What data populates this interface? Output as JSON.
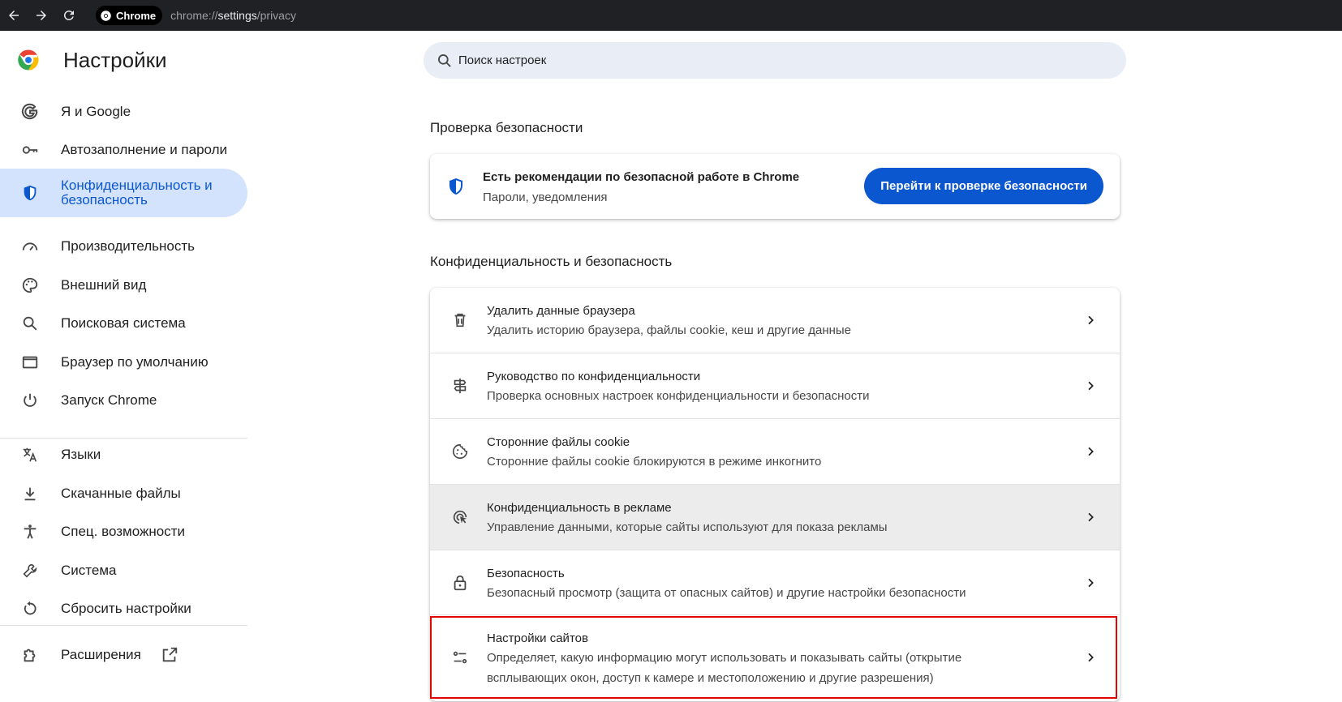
{
  "browser": {
    "chip_label": "Chrome",
    "url_prefix": "chrome://",
    "url_main": "settings",
    "url_suffix": "/privacy"
  },
  "sidebar": {
    "title": "Настройки",
    "items": [
      {
        "label": "Я и Google",
        "icon": "google-g-icon"
      },
      {
        "label": "Автозаполнение и пароли",
        "icon": "key-icon"
      },
      {
        "label": "Конфиденциальность и безопасность",
        "icon": "shield-icon",
        "active": true
      },
      {
        "label": "Производительность",
        "icon": "speedometer-icon"
      },
      {
        "label": "Внешний вид",
        "icon": "palette-icon"
      },
      {
        "label": "Поисковая система",
        "icon": "search-icon"
      },
      {
        "label": "Браузер по умолчанию",
        "icon": "browser-window-icon"
      },
      {
        "label": "Запуск Chrome",
        "icon": "power-icon"
      },
      {
        "label": "Языки",
        "icon": "translate-icon"
      },
      {
        "label": "Скачанные файлы",
        "icon": "download-icon"
      },
      {
        "label": "Спец. возможности",
        "icon": "accessibility-icon"
      },
      {
        "label": "Система",
        "icon": "wrench-icon"
      },
      {
        "label": "Сбросить настройки",
        "icon": "reset-icon"
      },
      {
        "label": "Расширения",
        "icon": "puzzle-icon"
      }
    ]
  },
  "search": {
    "placeholder": "Поиск настроек"
  },
  "safety": {
    "section_title": "Проверка безопасности",
    "title": "Есть рекомендации по безопасной работе в Chrome",
    "subtitle": "Пароли, уведомления",
    "button": "Перейти к проверке безопасности"
  },
  "privacy": {
    "section_title": "Конфиденциальность и безопасность",
    "rows": [
      {
        "title": "Удалить данные браузера",
        "subtitle": "Удалить историю браузера, файлы cookie, кеш и другие данные",
        "icon": "trash-icon"
      },
      {
        "title": "Руководство по конфиденциальности",
        "subtitle": "Проверка основных настроек конфиденциальности и безопасности",
        "icon": "signpost-icon"
      },
      {
        "title": "Сторонние файлы cookie",
        "subtitle": "Сторонние файлы cookie блокируются в режиме инкогнито",
        "icon": "cookie-icon"
      },
      {
        "title": "Конфиденциальность в рекламе",
        "subtitle": "Управление данными, которые сайты используют для показа рекламы",
        "icon": "ad-target-icon"
      },
      {
        "title": "Безопасность",
        "subtitle": "Безопасный просмотр (защита от опасных сайтов) и другие настройки безопасности",
        "icon": "lock-icon"
      },
      {
        "title": "Настройки сайтов",
        "subtitle": "Определяет, какую информацию могут использовать и показывать сайты (открытие всплывающих окон, доступ к камере и местоположению и другие разрешения)",
        "icon": "tune-icon"
      }
    ]
  },
  "colors": {
    "accent": "#0b57d0",
    "active_bg": "#d3e3fd",
    "highlight": "#e10600"
  }
}
